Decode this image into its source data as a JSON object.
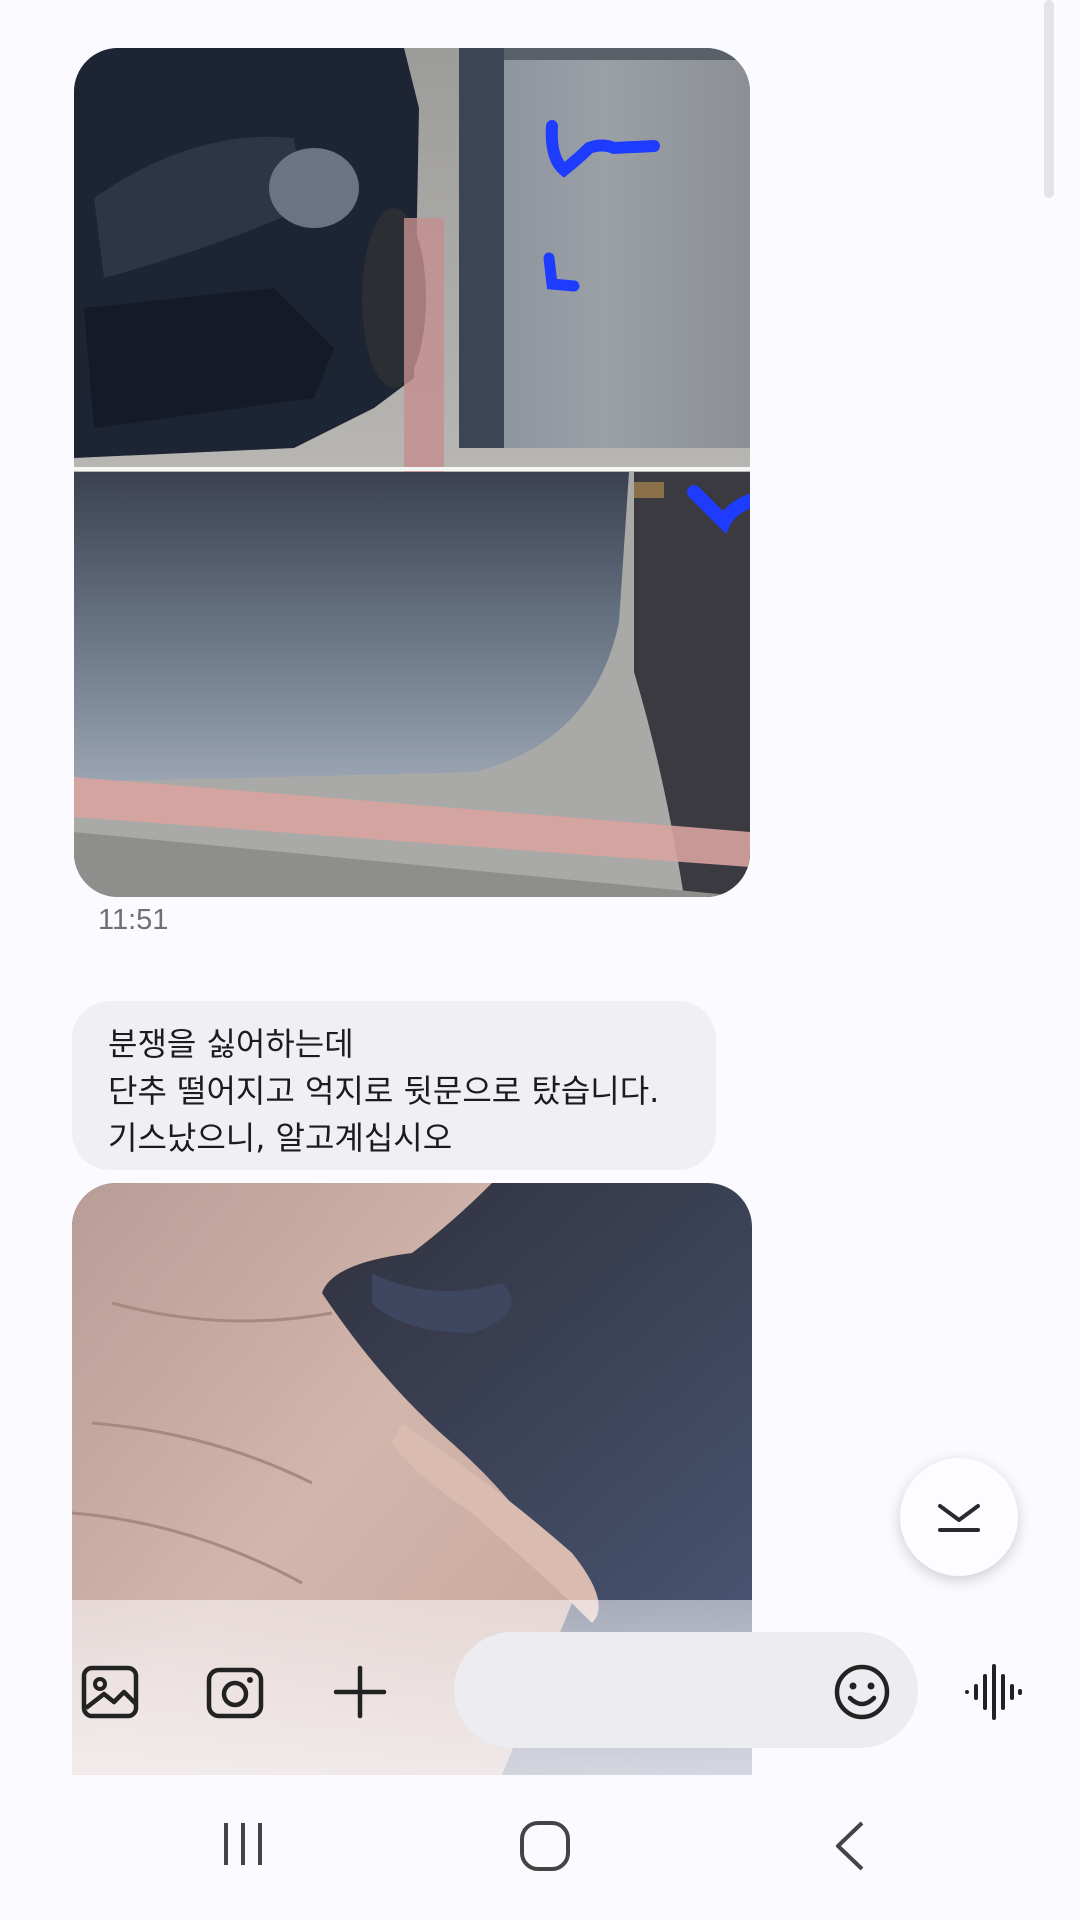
{
  "conversation": {
    "messages": [
      {
        "type": "image",
        "description_icon": "parking-photo"
      },
      {
        "type": "timestamp",
        "time": "11:51"
      },
      {
        "type": "text",
        "lines": [
          "분쟁을 싫어하는데",
          "단추 떨어지고 억지로 뒷문으로 탔습니다.",
          "기스났으니, 알고계십시오"
        ]
      },
      {
        "type": "image"
      }
    ]
  },
  "composer": {
    "placeholder": "",
    "icons": [
      "gallery-icon",
      "camera-icon",
      "plus-icon",
      "emoji-icon",
      "voice-icon"
    ]
  },
  "scroll_button": {
    "icon": "chevron-down-icon"
  },
  "navigation": {
    "icons": [
      "recents-icon",
      "home-icon",
      "back-icon"
    ]
  },
  "colors": {
    "background": "#fbfafe",
    "bubble": "#f0eff4",
    "scribble": "#1e3cff"
  }
}
